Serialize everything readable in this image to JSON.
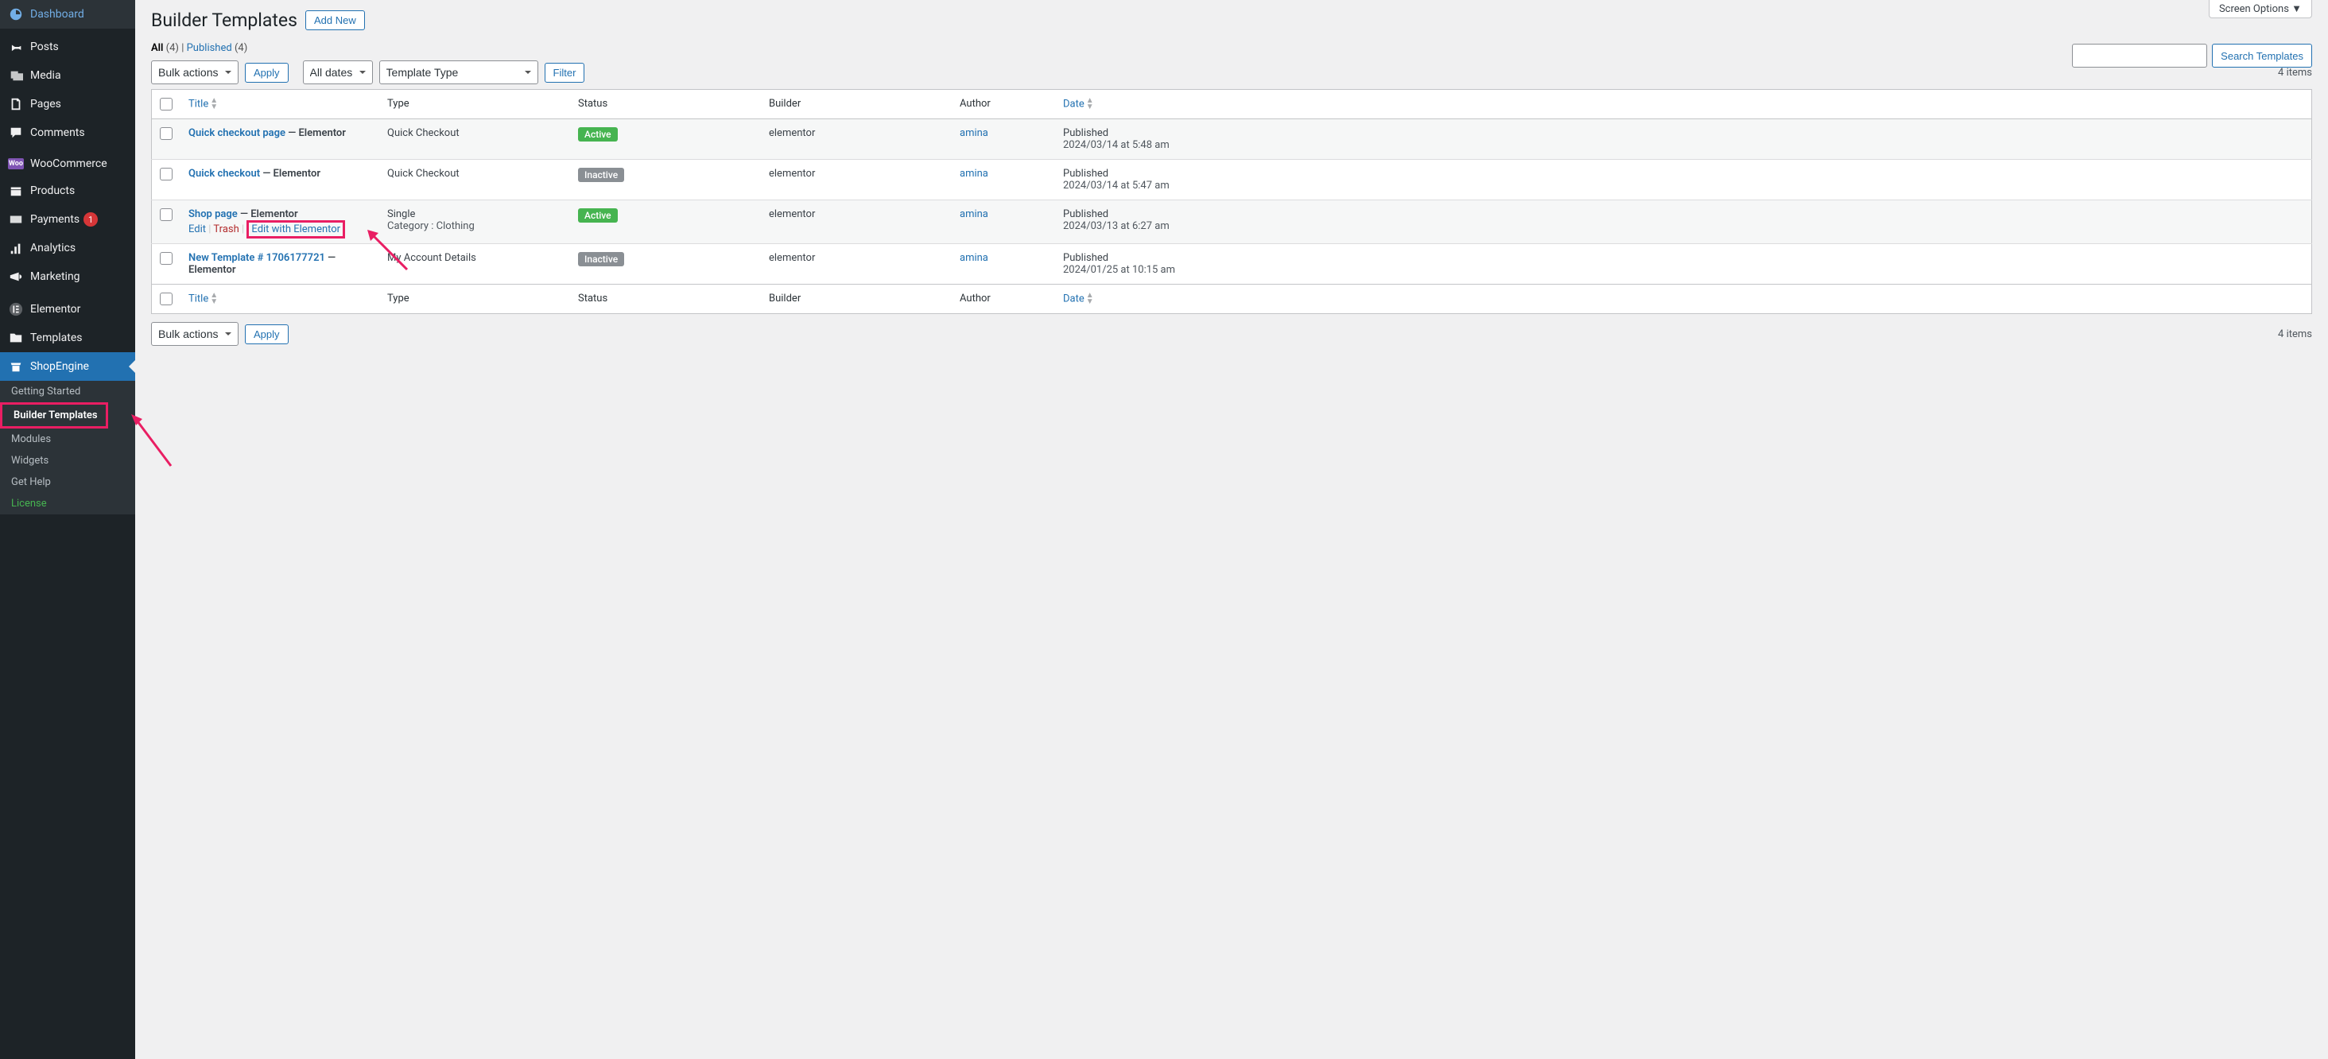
{
  "screen_options": "Screen Options  ▼",
  "page_title": "Builder Templates",
  "add_new": "Add New",
  "filters": {
    "all_label": "All",
    "all_count": "(4)",
    "sep": "  |  ",
    "published_label": "Published",
    "published_count": "(4)"
  },
  "search": {
    "button": "Search Templates"
  },
  "bulk": {
    "label": "Bulk actions",
    "apply": "Apply"
  },
  "dates": "All dates",
  "template_type": "Template Type",
  "filter": "Filter",
  "items_count": "4 items",
  "columns": {
    "title": "Title",
    "type": "Type",
    "status": "Status",
    "builder": "Builder",
    "author": "Author",
    "date": "Date"
  },
  "rows": [
    {
      "title": "Quick checkout page",
      "suffix": " — Elementor",
      "type": "Quick Checkout",
      "subtype": "",
      "status": "Active",
      "status_class": "status-active",
      "builder": "elementor",
      "author": "amina",
      "published": "Published",
      "date": "2024/03/14 at 5:48 am",
      "show_actions": false
    },
    {
      "title": "Quick checkout",
      "suffix": " — Elementor",
      "type": "Quick Checkout",
      "subtype": "",
      "status": "Inactive",
      "status_class": "status-inactive",
      "builder": "elementor",
      "author": "amina",
      "published": "Published",
      "date": "2024/03/14 at 5:47 am",
      "show_actions": false
    },
    {
      "title": "Shop page",
      "suffix": " — Elementor",
      "type": "Single",
      "subtype": "Category : Clothing",
      "status": "Active",
      "status_class": "status-active",
      "builder": "elementor",
      "author": "amina",
      "published": "Published",
      "date": "2024/03/13 at 6:27 am",
      "show_actions": true
    },
    {
      "title": "New Template # 1706177721",
      "suffix": " — Elementor",
      "type": "My Account Details",
      "subtype": "",
      "status": "Inactive",
      "status_class": "status-inactive",
      "builder": "elementor",
      "author": "amina",
      "published": "Published",
      "date": "2024/01/25 at 10:15 am",
      "show_actions": false
    }
  ],
  "row_actions": {
    "edit": "Edit",
    "trash": "Trash",
    "edit_elementor": "Edit with Elementor"
  },
  "sidebar": {
    "dashboard": "Dashboard",
    "posts": "Posts",
    "media": "Media",
    "pages": "Pages",
    "comments": "Comments",
    "woo": "WooCommerce",
    "products": "Products",
    "payments": "Payments",
    "payments_badge": "1",
    "analytics": "Analytics",
    "marketing": "Marketing",
    "elementor": "Elementor",
    "templates": "Templates",
    "shopengine": "ShopEngine",
    "sub": {
      "getting_started": "Getting Started",
      "builder_templates": "Builder Templates",
      "modules": "Modules",
      "widgets": "Widgets",
      "get_help": "Get Help",
      "license": "License"
    }
  }
}
